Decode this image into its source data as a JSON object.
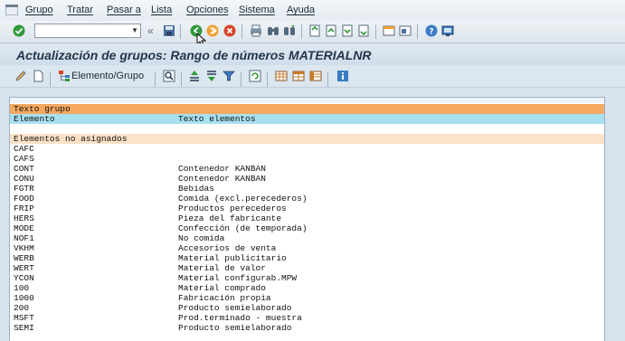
{
  "menu": {
    "items": [
      "Grupo",
      "Tratar",
      "Pasar a",
      "Lista",
      "Opciones",
      "Sistema",
      "Ayuda"
    ]
  },
  "toolbar": {
    "command_field_value": "",
    "back_symbol": "«"
  },
  "title": "Actualización de grupos: Rango de números MATERIALNR",
  "app_toolbar": {
    "element_group_label": "Elemento/Grupo"
  },
  "list": {
    "group_text_header": "Texto grupo",
    "col_element": "Elemento",
    "col_element_text": "Texto elementos",
    "unassigned_header": "Elementos no asignados",
    "rows": [
      {
        "element": "CAFC",
        "text": ""
      },
      {
        "element": "CAFS",
        "text": ""
      },
      {
        "element": "CONT",
        "text": "Contenedor KANBAN"
      },
      {
        "element": "CONU",
        "text": "Contenedor KANBAN"
      },
      {
        "element": "FGTR",
        "text": "Bebidas"
      },
      {
        "element": "FOOD",
        "text": "Comida (excl.perecederos)"
      },
      {
        "element": "FRIP",
        "text": "Productos perecederos"
      },
      {
        "element": "HERS",
        "text": "Pieza del fabricante"
      },
      {
        "element": "MODE",
        "text": "Confección (de temporada)"
      },
      {
        "element": "NOF1",
        "text": "No comida"
      },
      {
        "element": "VKHM",
        "text": "Accesorios de venta"
      },
      {
        "element": "WERB",
        "text": "Material publicitario"
      },
      {
        "element": "WERT",
        "text": "Material de valor"
      },
      {
        "element": "YCON",
        "text": "Material configurab.MPW"
      },
      {
        "element": "100",
        "text": "Material comprado"
      },
      {
        "element": "1000",
        "text": "Fabricación propia"
      },
      {
        "element": "200",
        "text": "Producto semielaborado"
      },
      {
        "element": "MSFT",
        "text": "Prod.terminado - muestra"
      },
      {
        "element": "SEMI",
        "text": "Producto semielaborado"
      }
    ]
  },
  "colors": {
    "header_orange": "#f5a860",
    "header_cyan": "#a8e0ef",
    "unassigned_header": "#fbe1c6",
    "check_green": "#2f9a3a",
    "cancel_red": "#d8442a",
    "exit_orange": "#f0a030"
  }
}
